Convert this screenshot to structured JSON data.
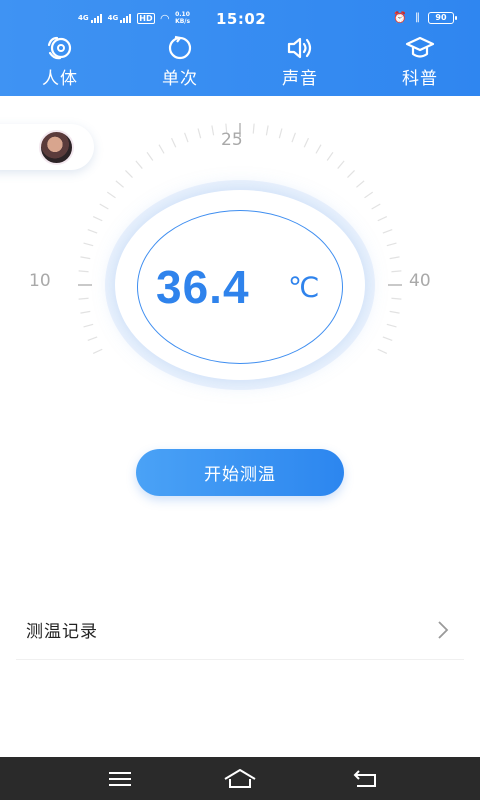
{
  "status_bar": {
    "signal1_label": "4G",
    "signal2_label": "4G",
    "hd_label": "HD",
    "net_speed": "0.10",
    "net_unit": "KB/s",
    "time": "15:02",
    "battery": "90"
  },
  "tabs": [
    {
      "label": "人体",
      "icon": "body-icon"
    },
    {
      "label": "单次",
      "icon": "single-icon"
    },
    {
      "label": "声音",
      "icon": "sound-icon"
    },
    {
      "label": "科普",
      "icon": "graduation-cap-icon"
    }
  ],
  "dial": {
    "scale_top": "25",
    "scale_left": "10",
    "scale_right": "40",
    "temperature": "36.4",
    "unit": "℃"
  },
  "start_button": {
    "label": "开始测温"
  },
  "record": {
    "label": "测温记录"
  },
  "colors": {
    "primary": "#2f86f0",
    "text_blue": "#2f83ec",
    "nav_bg": "#2a2a2a"
  }
}
